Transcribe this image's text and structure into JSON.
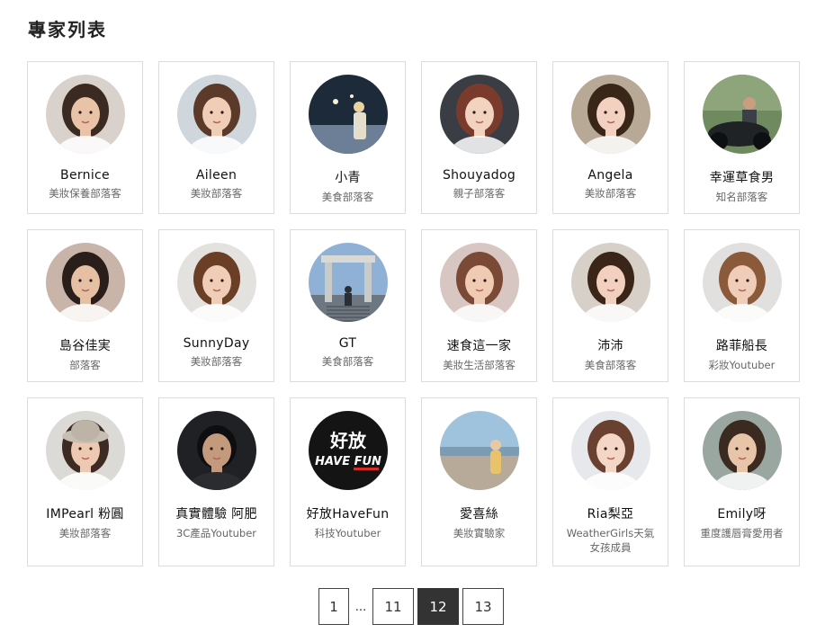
{
  "page_title": "專家列表",
  "experts": [
    {
      "name": "Bernice",
      "role": "美妝保養部落客",
      "avatar": "portrait-woman-icon",
      "bg": "#d9d2cc",
      "fg": "#3b2a22",
      "skin": "#e9c3a8"
    },
    {
      "name": "Aileen",
      "role": "美妝部落客",
      "avatar": "portrait-woman-icon",
      "bg": "#cfd6dc",
      "fg": "#5b3a2a",
      "skin": "#f0cdb6"
    },
    {
      "name": "小青",
      "role": "美食部落客",
      "avatar": "portrait-outdoor-icon",
      "bg": "#1d2a3a",
      "fg": "#c9c2b0",
      "skin": "#e8d2a0"
    },
    {
      "name": "Shouyadog",
      "role": "親子部落客",
      "avatar": "portrait-woman-icon",
      "bg": "#3a3d44",
      "fg": "#7a3b2c",
      "skin": "#f2d3c0"
    },
    {
      "name": "Angela",
      "role": "美妝部落客",
      "avatar": "portrait-woman-icon",
      "bg": "#b7a996",
      "fg": "#3a2618",
      "skin": "#f3d1c0"
    },
    {
      "name": "幸運草食男",
      "role": "知名部落客",
      "avatar": "portrait-motorbike-icon",
      "bg": "#6f8a5e",
      "fg": "#1f2326",
      "skin": "#c89e7e"
    },
    {
      "name": "島谷佳実",
      "role": "部落客",
      "avatar": "portrait-woman-icon",
      "bg": "#c8b4a8",
      "fg": "#2a1e1a",
      "skin": "#e6c0a4"
    },
    {
      "name": "SunnyDay",
      "role": "美妝部落客",
      "avatar": "portrait-woman-icon",
      "bg": "#e4e2df",
      "fg": "#6b3f26",
      "skin": "#efcdb6"
    },
    {
      "name": "GT",
      "role": "美食部落客",
      "avatar": "portrait-gate-icon",
      "bg": "#8fb1d6",
      "fg": "#5a6470",
      "skin": "#2a2f36"
    },
    {
      "name": "速食這一家",
      "role": "美妝生活部落客",
      "avatar": "portrait-woman-icon",
      "bg": "#d8c6c2",
      "fg": "#7a4a36",
      "skin": "#f0cbb4"
    },
    {
      "name": "沛沛",
      "role": "美食部落客",
      "avatar": "portrait-woman-icon",
      "bg": "#d6d0c8",
      "fg": "#3b2418",
      "skin": "#f2d0bf"
    },
    {
      "name": "路菲船長",
      "role": "彩妝Youtuber",
      "avatar": "portrait-woman-icon",
      "bg": "#e2e0de",
      "fg": "#8a5a3a",
      "skin": "#f0cdb8"
    },
    {
      "name": "IMPearl 粉圓",
      "role": "美妝部落客",
      "avatar": "portrait-hat-icon",
      "bg": "#dcdad6",
      "fg": "#3d2a22",
      "skin": "#edc9b2"
    },
    {
      "name": "真實體驗 阿肥",
      "role": "3C產品Youtuber",
      "avatar": "portrait-man-icon",
      "bg": "#1f2124",
      "fg": "#0e0e10",
      "skin": "#c49a7c"
    },
    {
      "name": "好放HaveFun",
      "role": "科技Youtuber",
      "avatar": "havefun-logo-icon",
      "bg": "#141414",
      "fg": "#ffffff",
      "skin": "#d62b2b"
    },
    {
      "name": "愛喜絲",
      "role": "美妝實驗家",
      "avatar": "portrait-beach-icon",
      "bg": "#9fc3dd",
      "fg": "#6a5b4c",
      "skin": "#e8c9a4"
    },
    {
      "name": "Ria梨亞",
      "role": "WeatherGirls天氣女孩成員",
      "avatar": "portrait-woman-icon",
      "bg": "#e6e8ec",
      "fg": "#6a4030",
      "skin": "#f4d6c6"
    },
    {
      "name": "Emily呀",
      "role": "重度護唇膏愛用者",
      "avatar": "portrait-woman-icon",
      "bg": "#9aa6a0",
      "fg": "#3a2a20",
      "skin": "#e8c4a8"
    }
  ],
  "havefun_logo": {
    "line1": "好放",
    "line2": "HAVE FUN"
  },
  "pagination": {
    "pages": [
      "1",
      "11",
      "12",
      "13"
    ],
    "ellipsis": "...",
    "current": "12"
  }
}
